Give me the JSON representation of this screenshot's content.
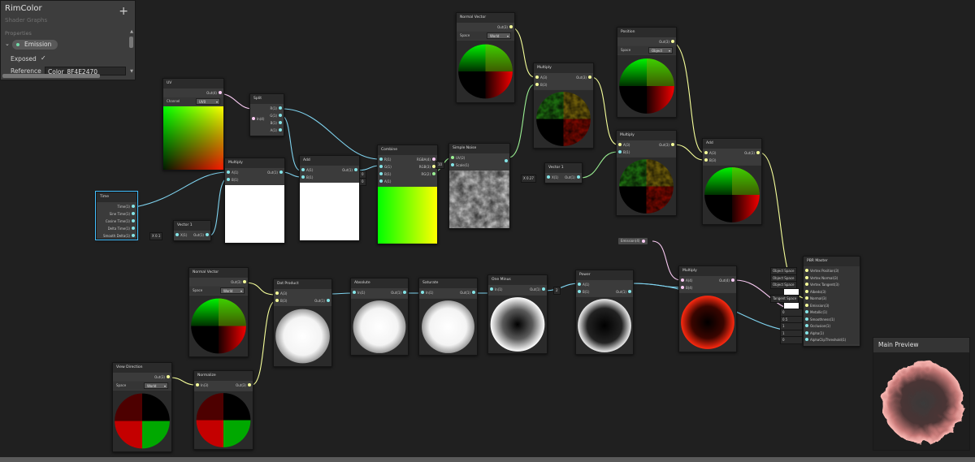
{
  "colors": {
    "wire": "#7fd3ef",
    "port_v1": "#84e4e7",
    "port_v2": "#9aef92",
    "port_v3": "#f6ff9a",
    "port_v4": "#fbcbf4",
    "selection": "#44c0ff",
    "prop_dot": "#72d9a8"
  },
  "blackboard": {
    "title": "RimColor",
    "subtitle": "Shader Graphs",
    "add_icon": "+",
    "section": "Properties",
    "property": "Emission",
    "exposed_label": "Exposed",
    "exposed_check": "✓",
    "reference_label": "Reference",
    "reference_value": "Color_8F4E2470"
  },
  "nodes": {
    "uv": {
      "title": "UV",
      "out": "Out(4)",
      "ctl_label": "Channel",
      "ctl_value": "UV0"
    },
    "split": {
      "title": "Split",
      "in": "In(4)",
      "r": "R(1)",
      "g": "G(1)",
      "b": "B(1)",
      "a": "A(1)"
    },
    "time": {
      "title": "Time",
      "outs": [
        "Time(1)",
        "Sine Time(1)",
        "Cosine Time(1)",
        "Delta Time(1)",
        "Smooth Delta(1)"
      ]
    },
    "vector1a": {
      "title": "Vector 1",
      "x_label": "X",
      "x_value": "0.1",
      "in": "X(1)",
      "out": "Out(1)"
    },
    "multiply1": {
      "title": "Multiply",
      "a": "A(1)",
      "b": "B(1)",
      "out": "Out(1)"
    },
    "add1": {
      "title": "Add",
      "a": "A(1)",
      "b": "B(1)",
      "out": "Out(1)"
    },
    "combine": {
      "title": "Combine",
      "r": "R(1)",
      "g": "G(1)",
      "b": "B(1)",
      "a": "A(1)",
      "rgba": "RGBA(4)",
      "rgb": "RGB(3)",
      "rg": "RG(2)",
      "b_val": "0",
      "a_val": "0"
    },
    "noise": {
      "title": "Simple Noise",
      "uv": "UV(2)",
      "scale": "Scale(1)",
      "scale_val": "10"
    },
    "normal1": {
      "title": "Normal Vector",
      "out": "Out(3)",
      "ctl_label": "Space",
      "ctl_value": "World"
    },
    "multiply2": {
      "title": "Multiply",
      "a": "A(3)",
      "b": "B(3)",
      "out": "Out(3)"
    },
    "vector1b": {
      "title": "Vector 1",
      "x_label": "X",
      "x_value": "0.27",
      "in": "X(1)",
      "out": "Out(1)"
    },
    "multiply3": {
      "title": "Multiply",
      "a": "A(3)",
      "b": "B(1)",
      "out": "Out(3)"
    },
    "position": {
      "title": "Position",
      "out": "Out(3)",
      "ctl_label": "Space",
      "ctl_value": "Object"
    },
    "add2": {
      "title": "Add",
      "a": "A(3)",
      "b": "B(3)",
      "out": "Out(3)"
    },
    "emission_prop": {
      "label": "Emission(4)"
    },
    "pbr": {
      "title": "PBR Master",
      "inputs": [
        "Vertex Position(3)",
        "Vertex Normal(3)",
        "Vertex Tangent(3)",
        "Albedo(3)",
        "Normal(3)",
        "Emission(3)",
        "Metallic(1)",
        "Smoothness(1)",
        "Occlusion(1)",
        "Alpha(1)",
        "AlphaClipThreshold(1)"
      ],
      "side": [
        "Object Space",
        "Object Space",
        "Object Space",
        "",
        "Tangent Space",
        "",
        "0",
        "0.5",
        "1",
        "1",
        "0"
      ]
    },
    "normal2": {
      "title": "Normal Vector",
      "out": "Out(3)",
      "ctl_label": "Space",
      "ctl_value": "World"
    },
    "dot": {
      "title": "Dot Product",
      "a": "A(3)",
      "b": "B(3)",
      "out": "Out(1)"
    },
    "absolute": {
      "title": "Absolute",
      "in": "In(1)",
      "out": "Out(1)"
    },
    "saturate": {
      "title": "Saturate",
      "in": "In(1)",
      "out": "Out(1)"
    },
    "oneminus": {
      "title": "One Minus",
      "in": "In(1)",
      "out": "Out(1)"
    },
    "power": {
      "title": "Power",
      "a": "A(1)",
      "b": "B(1)",
      "b_val": "2",
      "out": "Out(1)"
    },
    "multiply4": {
      "title": "Multiply",
      "a": "A(4)",
      "b": "B(4)",
      "out": "Out(4)"
    },
    "viewdir": {
      "title": "View Direction",
      "out": "Out(3)",
      "ctl_label": "Space",
      "ctl_value": "World"
    },
    "normalize": {
      "title": "Normalize",
      "in": "In(3)",
      "out": "Out(3)"
    }
  },
  "main_preview": {
    "title": "Main Preview"
  }
}
